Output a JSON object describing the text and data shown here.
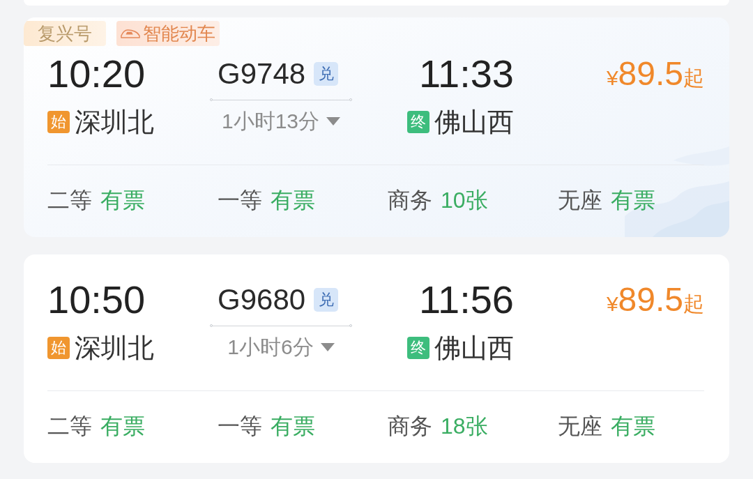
{
  "trains": [
    {
      "highlighted": true,
      "tags": [
        {
          "kind": "series",
          "label": "复兴号"
        },
        {
          "kind": "smart",
          "label": "智能动车"
        }
      ],
      "depart_time": "10:20",
      "depart_station": {
        "kind": "origin",
        "badge": "始",
        "name": "深圳北"
      },
      "train_no": "G9748",
      "train_badge": "兑",
      "duration": "1小时13分",
      "arrive_time": "11:33",
      "arrive_station": {
        "kind": "terminus",
        "badge": "终",
        "name": "佛山西"
      },
      "price": {
        "currency": "¥",
        "amount": "89.5",
        "suffix": "起"
      },
      "seats": [
        {
          "class": "二等",
          "availability": "有票"
        },
        {
          "class": "一等",
          "availability": "有票"
        },
        {
          "class": "商务",
          "availability": "10张"
        },
        {
          "class": "无座",
          "availability": "有票"
        }
      ]
    },
    {
      "highlighted": false,
      "depart_time": "10:50",
      "depart_station": {
        "kind": "origin",
        "badge": "始",
        "name": "深圳北"
      },
      "train_no": "G9680",
      "train_badge": "兑",
      "duration": "1小时6分",
      "arrive_time": "11:56",
      "arrive_station": {
        "kind": "terminus",
        "badge": "终",
        "name": "佛山西"
      },
      "price": {
        "currency": "¥",
        "amount": "89.5",
        "suffix": "起"
      },
      "seats": [
        {
          "class": "二等",
          "availability": "有票"
        },
        {
          "class": "一等",
          "availability": "有票"
        },
        {
          "class": "商务",
          "availability": "18张"
        },
        {
          "class": "无座",
          "availability": "有票"
        }
      ]
    }
  ]
}
